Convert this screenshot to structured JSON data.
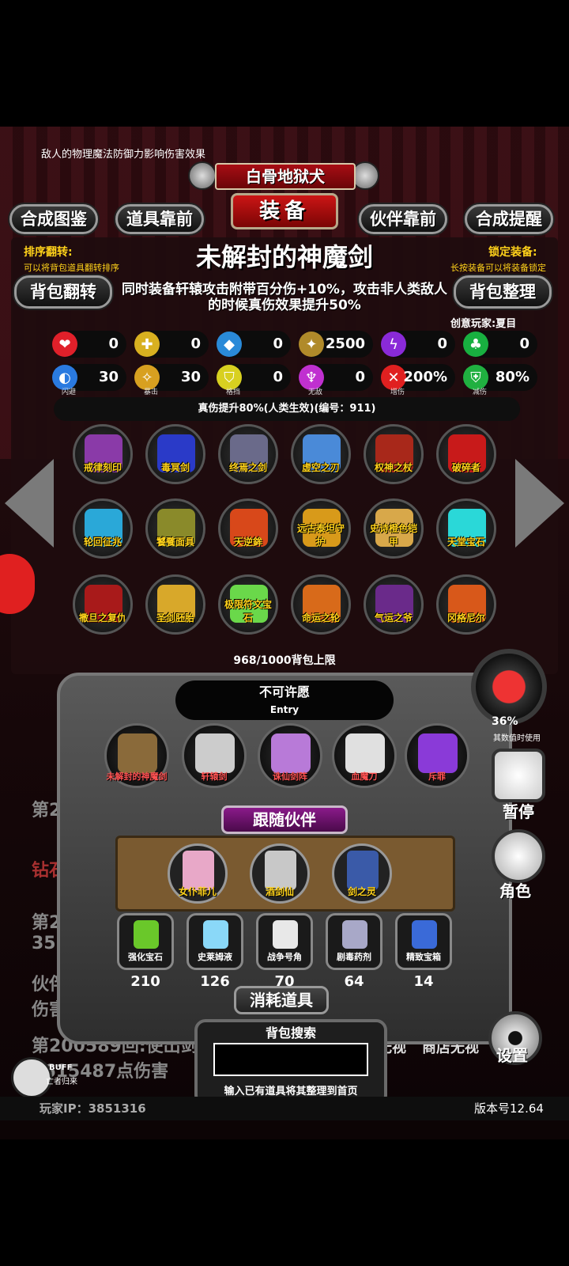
{
  "top_note": "敌人的物理魔法防御力影响伤害效果",
  "banner": "白骨地狱犬",
  "equip_badge": "装备",
  "nav": {
    "left1": "合成图鉴",
    "left2": "道具靠前",
    "right1": "伙伴靠前",
    "right2": "合成提醒"
  },
  "sort": {
    "title": "排序翻转:",
    "sub": "可以将背包道具翻转排序",
    "button": "背包翻转"
  },
  "lock": {
    "title": "锁定装备:",
    "sub": "长按装备可以将装备锁定",
    "button": "背包整理"
  },
  "item": {
    "name": "未解封的神魔剑",
    "desc": "同时装备轩辕攻击附带百分伤+10%，攻击非人类敌人的时候真伤效果提升50%",
    "creator": "创意玩家:夏目"
  },
  "stats_row1": [
    {
      "icon": "heart-icon",
      "glyph": "❤",
      "color": "#e0202a",
      "value": "0"
    },
    {
      "icon": "armor-icon",
      "glyph": "✚",
      "color": "#d8b020",
      "value": "0"
    },
    {
      "icon": "helmet-icon",
      "glyph": "◆",
      "color": "#2a8ad8",
      "value": "0"
    },
    {
      "icon": "sword-icon",
      "glyph": "✦",
      "color": "#b08a2a",
      "value": "2500"
    },
    {
      "icon": "lightning-icon",
      "glyph": "ϟ",
      "color": "#8a2ad8",
      "value": "0"
    },
    {
      "icon": "clover-icon",
      "glyph": "♣",
      "color": "#18b040",
      "value": "0"
    }
  ],
  "stats_row2": [
    {
      "icon": "dodge-icon",
      "glyph": "◐",
      "color": "#2a7ae0",
      "value": "30",
      "caption": "闪避"
    },
    {
      "icon": "crit-icon",
      "glyph": "✧",
      "color": "#d8a020",
      "value": "30",
      "caption": "暴击"
    },
    {
      "icon": "block-icon",
      "glyph": "⛉",
      "color": "#d8d020",
      "value": "0",
      "caption": "格挡"
    },
    {
      "icon": "invincible-icon",
      "glyph": "♆",
      "color": "#c030d0",
      "value": "0",
      "caption": "无敌"
    },
    {
      "icon": "damage-up-icon",
      "glyph": "✕",
      "color": "#e02020",
      "value": "200%",
      "caption": "增伤"
    },
    {
      "icon": "damage-reduce-icon",
      "glyph": "⛨",
      "color": "#20b040",
      "value": "80%",
      "caption": "减伤"
    }
  ],
  "true_damage": "真伤提升80%(人类生效)(编号：911)",
  "bag_items": [
    {
      "label": "戒律刻印",
      "color": "#8a3aa8"
    },
    {
      "label": "毒冥剑",
      "color": "#2a3ac8"
    },
    {
      "label": "终焉之剑",
      "color": "#6a6a8a"
    },
    {
      "label": "虚空之刃",
      "color": "#4a8ad8"
    },
    {
      "label": "权神之杖",
      "color": "#a8281a"
    },
    {
      "label": "破碎者",
      "color": "#c81a1a"
    },
    {
      "label": "轮回征兆",
      "color": "#2aa8d8"
    },
    {
      "label": "饕餮面具",
      "color": "#8a8a2a"
    },
    {
      "label": "天逆鉾",
      "color": "#d8481a"
    },
    {
      "label": "远古泰坦守护",
      "color": "#d89a1a"
    },
    {
      "label": "史诗橙色铠甲",
      "color": "#d8a84a"
    },
    {
      "label": "天堂宝石",
      "color": "#2ad8d8"
    },
    {
      "label": "撒旦之复仇",
      "color": "#a81a1a"
    },
    {
      "label": "圣剑胚胎",
      "color": "#d8a82a"
    },
    {
      "label": "极限符文宝石",
      "color": "#6ad84a"
    },
    {
      "label": "命运之轮",
      "color": "#d86a1a"
    },
    {
      "label": "气运之爷",
      "color": "#6a2a8a"
    },
    {
      "label": "冈格尼尔",
      "color": "#d8581a"
    }
  ],
  "bag_capacity": "968/1000背包上限",
  "wish": {
    "title": "不可许愿",
    "sub": "Entry"
  },
  "equipped": [
    {
      "label": "未解封的神魔剑",
      "color": "#8a6a3a"
    },
    {
      "label": "轩辕剑",
      "color": "#cccccc"
    },
    {
      "label": "诛仙剑阵",
      "color": "#b87ad8"
    },
    {
      "label": "血魔刀",
      "color": "#e0e0e0"
    },
    {
      "label": "斥罪",
      "color": "#8a3ad8"
    }
  ],
  "follow_title": "跟随伙伴",
  "partners": [
    {
      "label": "女仆菲儿",
      "color": "#e8a8c8"
    },
    {
      "label": "酒剑仙",
      "color": "#c8c8c8"
    },
    {
      "label": "剑之灵",
      "color": "#3a5aa8"
    }
  ],
  "consumables": [
    {
      "label": "强化宝石",
      "count": "210",
      "color": "#6ac82a"
    },
    {
      "label": "史莱姆液",
      "count": "126",
      "color": "#8ad8f8"
    },
    {
      "label": "战争号角",
      "count": "70",
      "color": "#e8e8e8"
    },
    {
      "label": "剧毒药剂",
      "count": "64",
      "color": "#a8a8c8"
    },
    {
      "label": "精致宝箱",
      "count": "14",
      "color": "#3a6ad8"
    }
  ],
  "consume_title": "消耗道具",
  "search": {
    "title": "背包搜索",
    "placeholder": "",
    "hint": "输入已有道具将其整理到首页"
  },
  "side": {
    "pause": "暂停",
    "role": "角色",
    "settings": "设置",
    "pct": "36%",
    "pct_sub": "其数值时使用"
  },
  "background_log": [
    "第2",
    "钻石",
    "第20",
    "352",
    "伙伴",
    "伤害",
    "第200589回:使出剑",
    "4615487点伤害",
    "无视",
    "商店无视"
  ],
  "buff": {
    "label": "BUFF",
    "sub": "亡者归来"
  },
  "player_ip": "玩家IP：3851316",
  "version": "版本号12.64"
}
